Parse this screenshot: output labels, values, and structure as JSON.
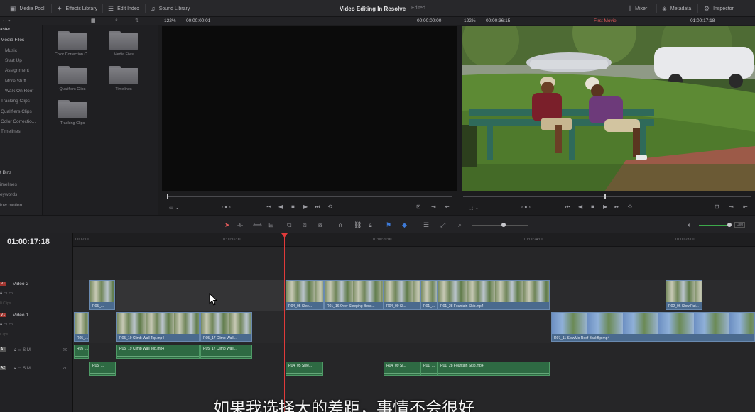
{
  "topbar": {
    "media_pool": "Media Pool",
    "effects_library": "Effects Library",
    "edit_index": "Edit Index",
    "sound_library": "Sound Library",
    "project_title": "Video Editing In Resolve",
    "status": "Edited",
    "mixer": "Mixer",
    "metadata": "Metadata",
    "inspector": "Inspector"
  },
  "source_viewer": {
    "zoom": "122%",
    "timecode_in": "00:00:00:01",
    "timecode_out": "00:00:00:00"
  },
  "timeline_viewer": {
    "zoom": "122%",
    "duration": "00:00:36:15",
    "timeline_name": "First Movie",
    "timecode": "01:00:17:18"
  },
  "bins": {
    "master": "aster",
    "items": [
      "Media Files",
      "Music",
      "Start Up",
      "Assignment",
      "More Stuff",
      "Walk On Roof",
      "Tracking Clips",
      "Qualifiers Clips",
      "Color Correctio...",
      "Timelines"
    ],
    "smart_bins_header": "t Bins",
    "smart_bins": [
      "imelines",
      "eywords",
      "low motion"
    ]
  },
  "folders": [
    "Color Correction C...",
    "Media Files",
    "Qualifiers Clips",
    "Timelines",
    "Tracking Clips"
  ],
  "timeline": {
    "timecode": "01:00:17:18",
    "ruler": [
      "00:12:00",
      "01:00:16:00",
      "01:00:20:00",
      "01:00:24:00",
      "01:00:28:00"
    ],
    "tracks": [
      {
        "id": "V2",
        "name": "Video 2",
        "badge": "V1",
        "sub": "0 Clips"
      },
      {
        "id": "V1",
        "name": "Video 1",
        "badge": "V1",
        "sub": "Clips"
      },
      {
        "id": "A1",
        "name": "",
        "badge": "A1",
        "level": "2.0"
      },
      {
        "id": "A2",
        "name": "",
        "badge": "A2",
        "level": "2.0"
      }
    ],
    "v2_clips": [
      "R05_...",
      "R04_05 Slee...",
      "R01_16 Over Sleeping Benc...",
      "R04_09 Sl...",
      "R01_...",
      "R01_28 Fountain Skip.mp4",
      "R02_06 Slow Rai..."
    ],
    "v1_clips": [
      "R05_...",
      "R05_19 Climb Wall Top.mp4",
      "R05_17 Climb Wall...",
      "R07_11 SlowMo Roof Backflip.mp4"
    ],
    "a1_clips": [
      "R05_...",
      "R05_19 Climb Wall Top.mp4",
      "R05_17 Climb Wall..."
    ],
    "a2_clips": [
      "R05_...",
      "R04_05 Slee...",
      "R04_09 Sl...",
      "R01_...",
      "R01_28 Fountain Skip.mp4"
    ],
    "audio_meter": "DIM"
  },
  "subtitle": "如果我选择大的差距，事情不会很好"
}
